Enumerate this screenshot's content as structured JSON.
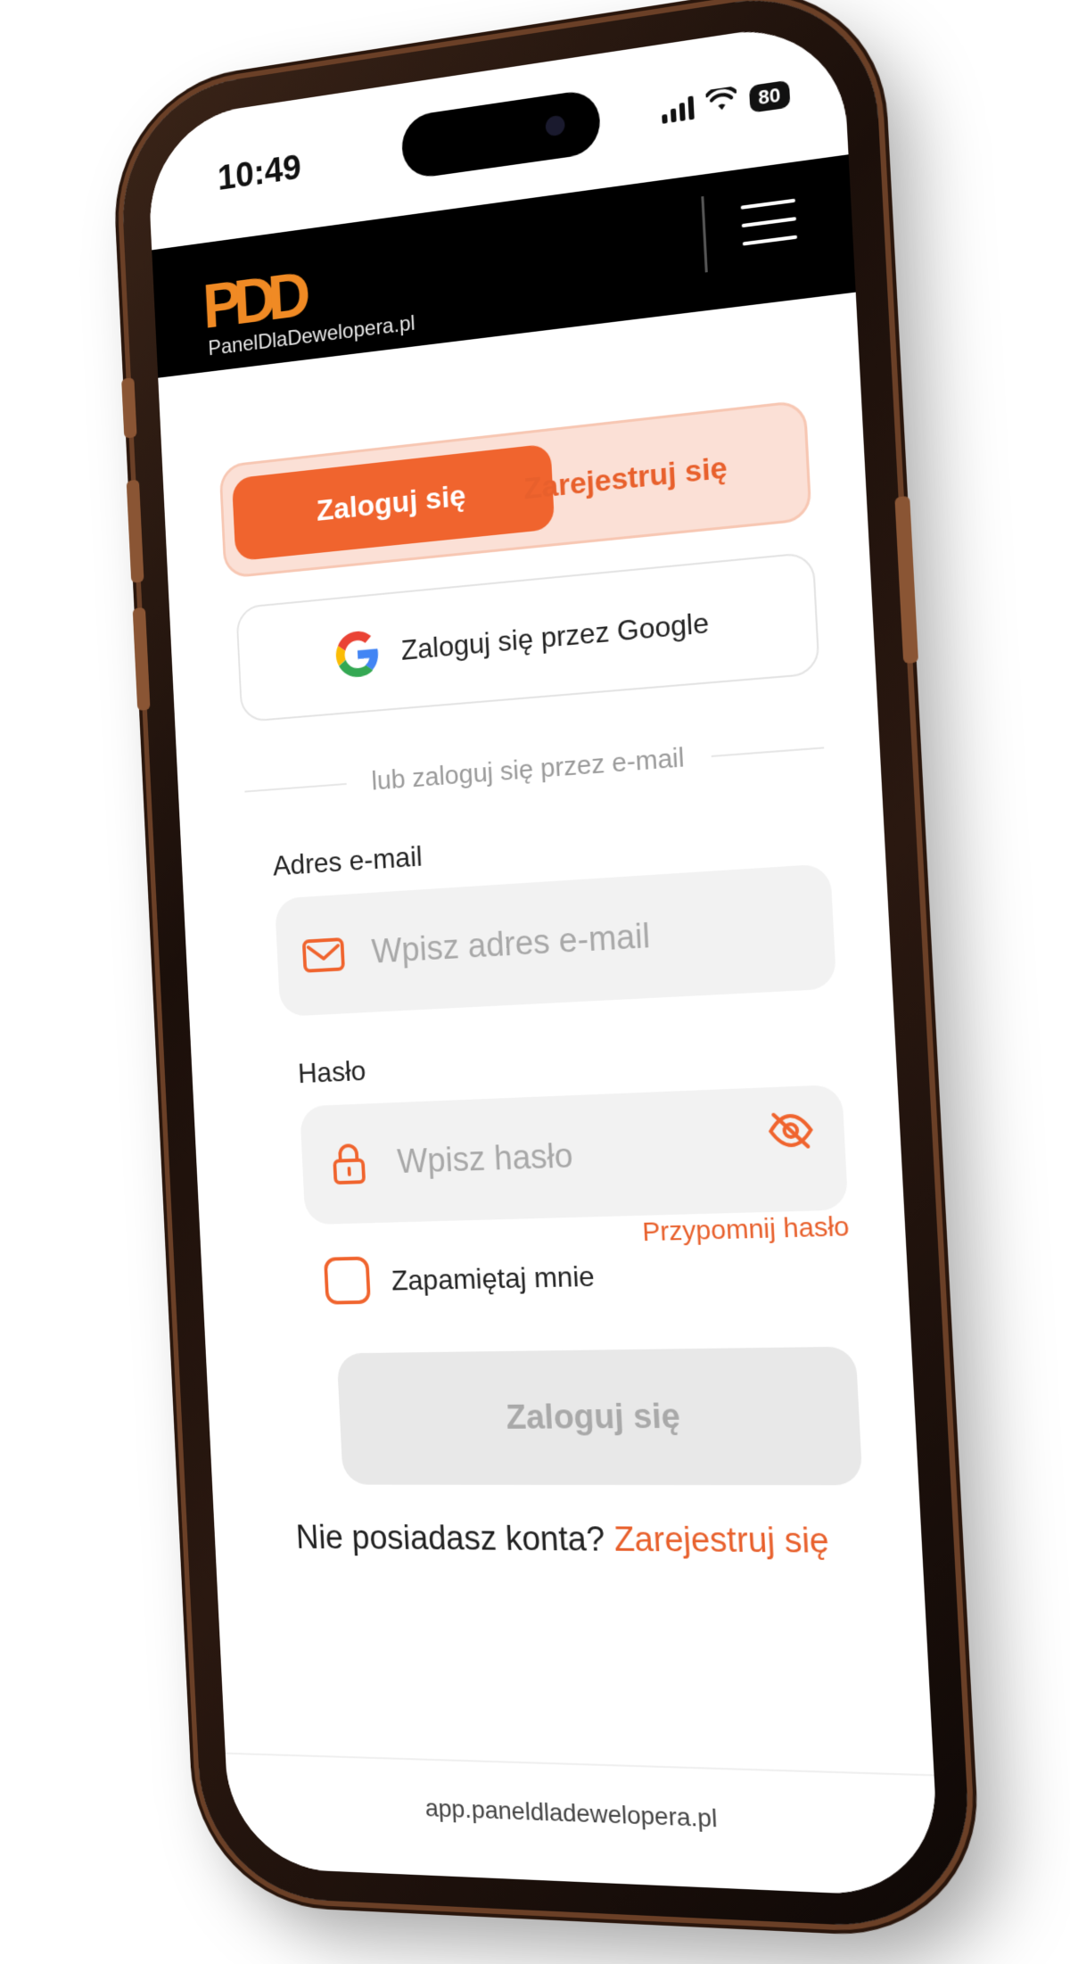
{
  "status_bar": {
    "time": "10:49",
    "battery": "80"
  },
  "header": {
    "logo_text": "PDD",
    "logo_subtitle": "PanelDlaDewelopera.pl",
    "menu_icon": "hamburger-icon"
  },
  "auth_tabs": {
    "login_label": "Zaloguj się",
    "register_label": "Zarejestruj się"
  },
  "google_button": {
    "label": "Zaloguj się przez Google",
    "icon": "google-icon"
  },
  "divider_text": "lub zaloguj się przez e-mail",
  "email": {
    "label": "Adres e-mail",
    "placeholder": "Wpisz adres e-mail",
    "value": "",
    "icon": "envelope-icon"
  },
  "password": {
    "label": "Hasło",
    "placeholder": "Wpisz hasło",
    "value": "",
    "icon": "lock-icon",
    "toggle_icon": "eye-off-icon"
  },
  "remember_me": {
    "label": "Zapamiętaj mnie",
    "checked": false
  },
  "forgot_password": "Przypomnij hasło",
  "submit_label": "Zaloguj się",
  "signup_prompt": {
    "text": "Nie posiadasz konta?",
    "link": "Zarejestruj się"
  },
  "footer_url": "app.paneldladewelopera.pl",
  "colors": {
    "accent": "#f0642e",
    "accent_light": "#fbe0d6",
    "logo": "#f08a24",
    "header_bg": "#000000",
    "disabled_bg": "#e8e8e8"
  }
}
